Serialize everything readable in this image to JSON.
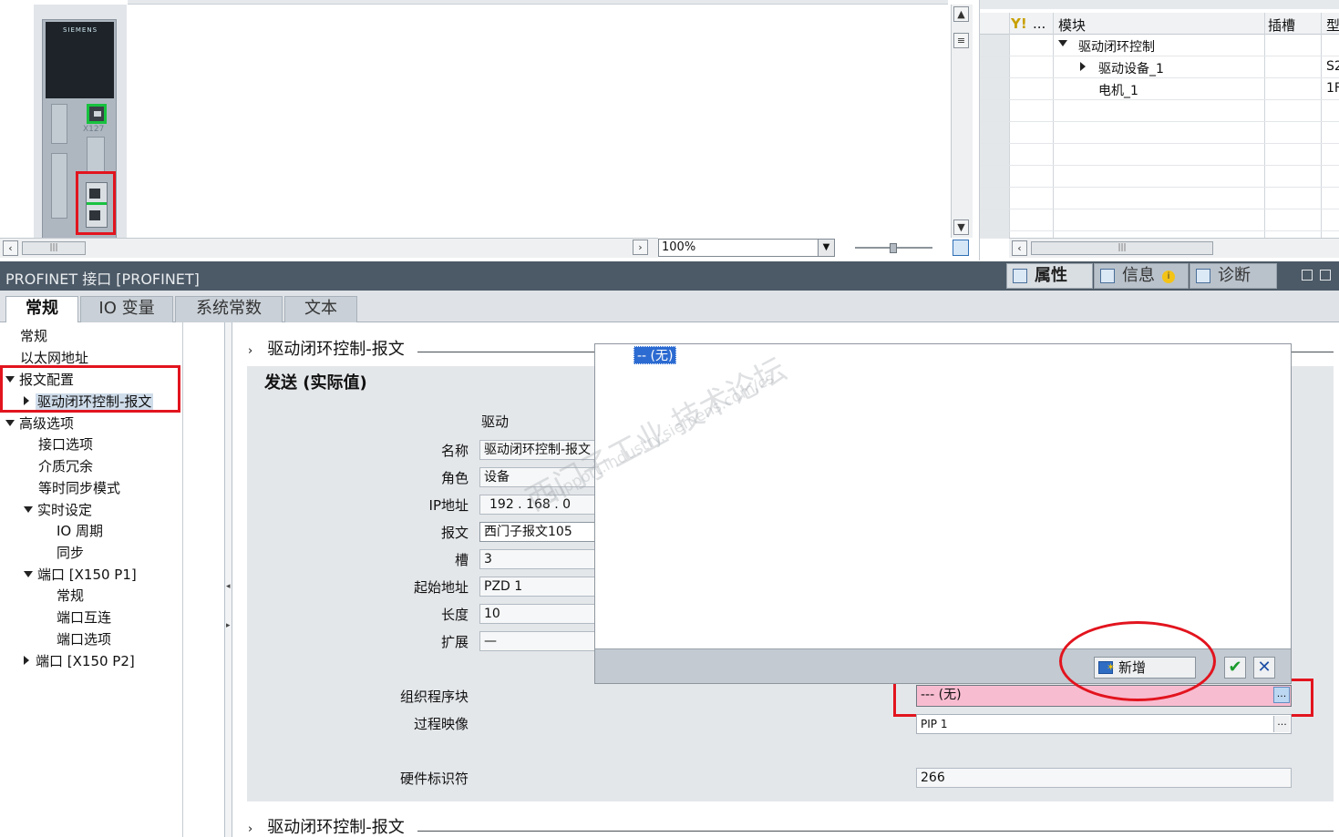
{
  "device_view": {
    "brand": "SIEMENS",
    "port_label": "X127",
    "zoom": "100%"
  },
  "overview": {
    "headers": [
      "...",
      "模块",
      "插槽",
      "型"
    ],
    "rows": [
      {
        "module": "驱动闭环控制",
        "slot": "",
        "type": ""
      },
      {
        "module": "驱动设备_1",
        "slot": "",
        "type": "S2"
      },
      {
        "module": "电机_1",
        "slot": "",
        "type": "1F"
      }
    ]
  },
  "inspector": {
    "title": "PROFINET 接口 [PROFINET]",
    "tabs": [
      {
        "label": "属性",
        "icon": "properties-icon"
      },
      {
        "label": "信息",
        "icon": "info-icon"
      },
      {
        "label": "诊断",
        "icon": "diagnostics-icon"
      }
    ],
    "info_badge": "i"
  },
  "property_tabs": [
    "常规",
    "IO 变量",
    "系统常数",
    "文本"
  ],
  "nav": [
    {
      "label": "常规"
    },
    {
      "label": "以太网地址"
    },
    {
      "label": "报文配置"
    },
    {
      "label": "驱动闭环控制-报文"
    },
    {
      "label": "高级选项"
    },
    {
      "label": "接口选项"
    },
    {
      "label": "介质冗余"
    },
    {
      "label": "等时同步模式"
    },
    {
      "label": "实时设定"
    },
    {
      "label": "IO 周期"
    },
    {
      "label": "同步"
    },
    {
      "label": "端口 [X150 P1]"
    },
    {
      "label": "常规"
    },
    {
      "label": "端口互连"
    },
    {
      "label": "端口选项"
    },
    {
      "label": "端口 [X150 P2]"
    }
  ],
  "content": {
    "section_title": "驱动闭环控制-报文",
    "section_title_bottom": "驱动闭环控制-报文",
    "subsection": "发送 (实际值)",
    "column_header": "驱动",
    "fields": [
      {
        "label": "名称",
        "value": "驱动闭环控制-报文"
      },
      {
        "label": "角色",
        "value": "设备"
      },
      {
        "label": "IP地址",
        "value": "192 . 168 . 0"
      },
      {
        "label": "报文",
        "value": "西门子报文105"
      },
      {
        "label": "槽",
        "value": "3"
      },
      {
        "label": "起始地址",
        "value": "PZD 1"
      },
      {
        "label": "长度",
        "value": "10"
      },
      {
        "label": "扩展",
        "value": "—"
      }
    ],
    "ob_label": "组织程序块",
    "ob_value": "--- (无)",
    "pip_label": "过程映像",
    "pip_value": "PIP 1",
    "hw_label": "硬件标识符",
    "hw_value": "266",
    "browse": "..."
  },
  "popup": {
    "selected_item": "-- (无)",
    "new_button": "新增",
    "ok": "✔",
    "cancel": "✕"
  },
  "watermark": {
    "text": "西门子工业  技术论坛",
    "url": "support.industry.siemens.com/cs"
  },
  "colors": {
    "highlight_red": "#e2141e",
    "selection_blue": "#2c6bd1",
    "pink_field": "#f8bcd0",
    "header_dark": "#4c5966"
  }
}
